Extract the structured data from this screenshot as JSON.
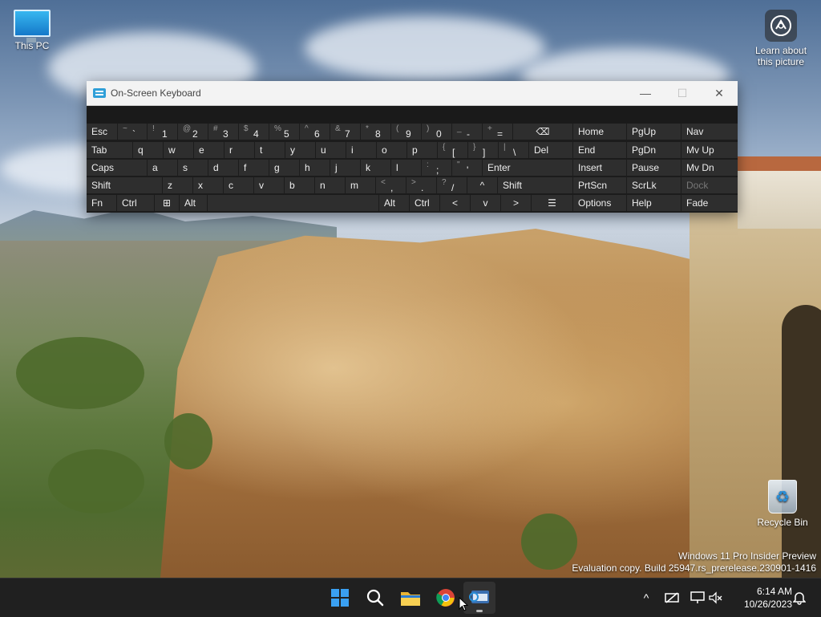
{
  "desktop": {
    "icons": {
      "this_pc": "This PC",
      "learn": "Learn about this picture",
      "recycle_bin": "Recycle Bin"
    },
    "watermark": {
      "line1": "Windows 11 Pro Insider Preview",
      "line2": "Evaluation copy. Build 25947.rs_prerelease.230901-1416"
    }
  },
  "osk": {
    "title": "On-Screen Keyboard",
    "controls": {
      "minimize": "—",
      "maximize": "☐",
      "close": "✕"
    },
    "row1": {
      "esc": "Esc",
      "backquote": {
        "shift": "~",
        "main": "`"
      },
      "digits": [
        {
          "shift": "!",
          "main": "1"
        },
        {
          "shift": "@",
          "main": "2"
        },
        {
          "shift": "#",
          "main": "3"
        },
        {
          "shift": "$",
          "main": "4"
        },
        {
          "shift": "%",
          "main": "5"
        },
        {
          "shift": "^",
          "main": "6"
        },
        {
          "shift": "&",
          "main": "7"
        },
        {
          "shift": "*",
          "main": "8"
        },
        {
          "shift": "(",
          "main": "9"
        },
        {
          "shift": ")",
          "main": "0"
        },
        {
          "shift": "_",
          "main": "-"
        },
        {
          "shift": "+",
          "main": "="
        }
      ],
      "backspace": "⌫"
    },
    "row2": {
      "tab": "Tab",
      "letters": [
        "q",
        "w",
        "e",
        "r",
        "t",
        "y",
        "u",
        "i",
        "o",
        "p"
      ],
      "lbracket": {
        "shift": "{",
        "main": "["
      },
      "rbracket": {
        "shift": "}",
        "main": "]"
      },
      "backslash": {
        "shift": "|",
        "main": "\\"
      },
      "del": "Del"
    },
    "row3": {
      "caps": "Caps",
      "letters": [
        "a",
        "s",
        "d",
        "f",
        "g",
        "h",
        "j",
        "k",
        "l"
      ],
      "semicolon": {
        "shift": ":",
        "main": ";"
      },
      "quote": {
        "shift": "\"",
        "main": "'"
      },
      "enter": "Enter"
    },
    "row4": {
      "shift_left": "Shift",
      "letters": [
        "z",
        "x",
        "c",
        "v",
        "b",
        "n",
        "m"
      ],
      "comma": {
        "shift": "<",
        "main": ","
      },
      "period": {
        "shift": ">",
        "main": "."
      },
      "slash": {
        "shift": "?",
        "main": "/"
      },
      "up": "^",
      "shift_right": "Shift"
    },
    "row5": {
      "fn": "Fn",
      "ctrl_left": "Ctrl",
      "win": "⊞",
      "alt_left": "Alt",
      "alt_right": "Alt",
      "ctrl_right": "Ctrl",
      "left": "<",
      "down": "v",
      "right": ">",
      "menu": "☰"
    },
    "nav_keys": [
      [
        "Home",
        "PgUp",
        "Nav"
      ],
      [
        "End",
        "PgDn",
        "Mv Up"
      ],
      [
        "Insert",
        "Pause",
        "Mv Dn"
      ],
      [
        "PrtScn",
        "ScrLk",
        "Dock"
      ],
      [
        "Options",
        "Help",
        "Fade"
      ]
    ]
  },
  "taskbar": {
    "clock_time": "6:14 AM",
    "clock_date": "10/26/2023",
    "tray_chevron": "^"
  },
  "icons": {
    "start": "windows-start-icon",
    "search": "search-icon",
    "explorer": "folder-icon",
    "chrome": "chrome-icon",
    "osk": "keyboard-icon"
  }
}
